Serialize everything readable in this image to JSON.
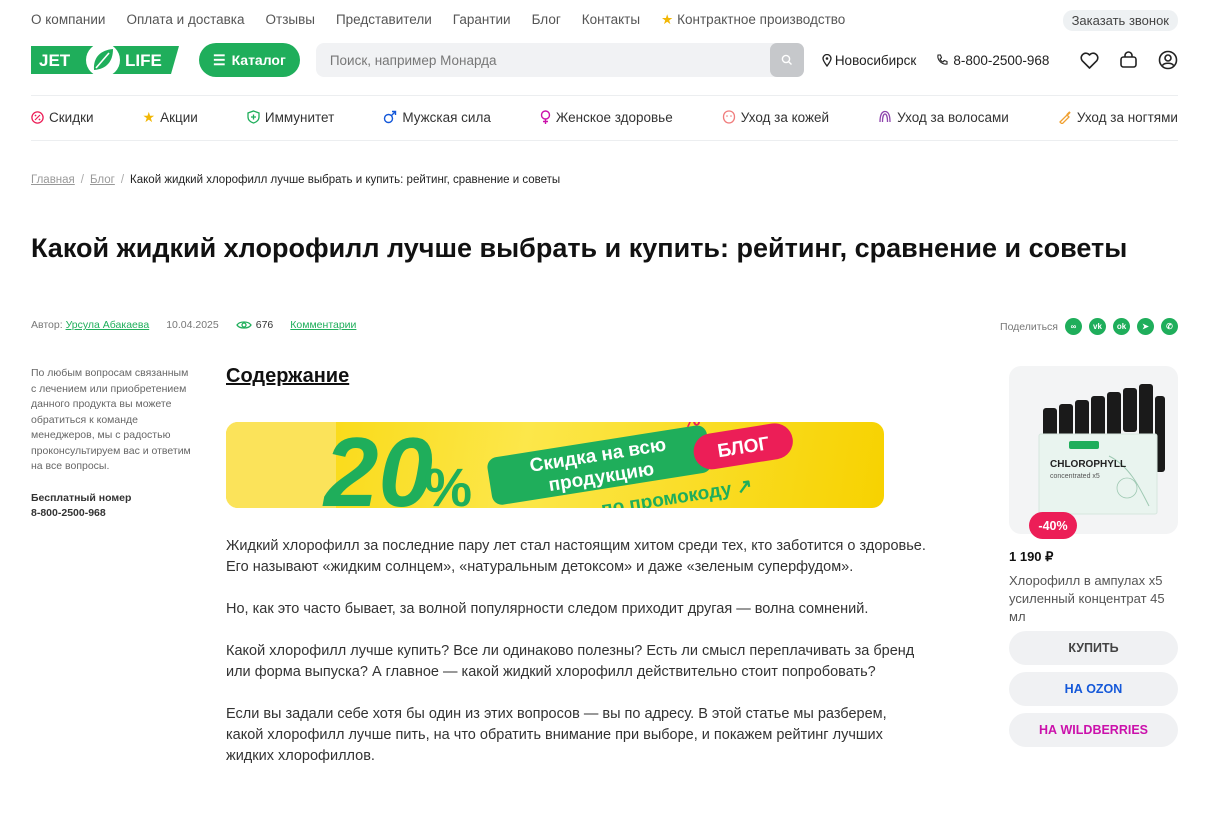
{
  "topnav": {
    "links": [
      "О компании",
      "Оплата и доставка",
      "Отзывы",
      "Представители",
      "Гарантии",
      "Блог",
      "Контакты"
    ],
    "contract": "Контрактное производство",
    "callback": "Заказать звонок"
  },
  "header": {
    "logo_left": "JET",
    "logo_right": "LIFE",
    "catalog": "Каталог",
    "search_placeholder": "Поиск, например Монарда",
    "city": "Новосибирск",
    "phone": "8-800-2500-968"
  },
  "categories": [
    "Скидки",
    "Акции",
    "Иммунитет",
    "Мужская сила",
    "Женское здоровье",
    "Уход за кожей",
    "Уход за волосами",
    "Уход за ногтями"
  ],
  "breadcrumb": {
    "home": "Главная",
    "blog": "Блог",
    "current": "Какой жидкий хлорофилл лучше выбрать и купить: рейтинг, сравнение и советы"
  },
  "article": {
    "title": "Какой жидкий хлорофилл лучше выбрать и купить: рейтинг, сравнение и советы",
    "author_label": "Автор:",
    "author": "Урсула Абакаева",
    "date": "10.04.2025",
    "views": "676",
    "comments": "Комментарии",
    "share_label": "Поделиться",
    "toc": "Содержание",
    "paragraphs": [
      "Жидкий хлорофилл за последние пару лет стал настоящим хитом среди тех, кто заботится о здоровье. Его называют «жидким солнцем», «натуральным детоксом» и даже «зеленым суперфудом».",
      "Но, как это часто бывает, за волной популярности следом приходит другая — волна сомнений.",
      "Какой хлорофилл лучше купить? Все ли одинаково полезны? Есть ли смысл переплачивать за бренд или форма выпуска? А главное — какой жидкий хлорофилл действительно стоит попробовать?",
      "Если вы задали себе хотя бы один из этих вопросов — вы по адресу. В этой статье мы разберем, какой хлорофилл лучше пить, на что обратить внимание при выборе, и покажем рейтинг лучших жидких хлорофиллов."
    ]
  },
  "banner": {
    "big": "20",
    "line1": "Скидка на всю",
    "line2": "продукцию",
    "blog": "БЛОГ",
    "promo": "по промокоду ↗"
  },
  "sidebar": {
    "text": "По любым вопросам связанным с лечением или приобретением данного продукта вы можете обратиться к команде менеджеров, мы с радостью проконсультируем вас и ответим на все вопросы.",
    "free_label": "Бесплатный номер",
    "free_phone": "8-800-2500-968"
  },
  "product": {
    "discount": "-40%",
    "price": "1 190 ₽",
    "name": "Хлорофилл в ампулах х5 усиленный концентрат 45 мл",
    "pack_title": "CHLOROPHYLL",
    "pack_sub": "concentrated x5",
    "buy": "КУПИТЬ",
    "ozon": "НА OZON",
    "wb": "НА WILDBERRIES"
  },
  "colors": {
    "brand_green": "#1fae5b",
    "discount_red": "#ec1e57",
    "ozon_blue": "#1458d9",
    "wb_purple": "#cb11ab"
  }
}
